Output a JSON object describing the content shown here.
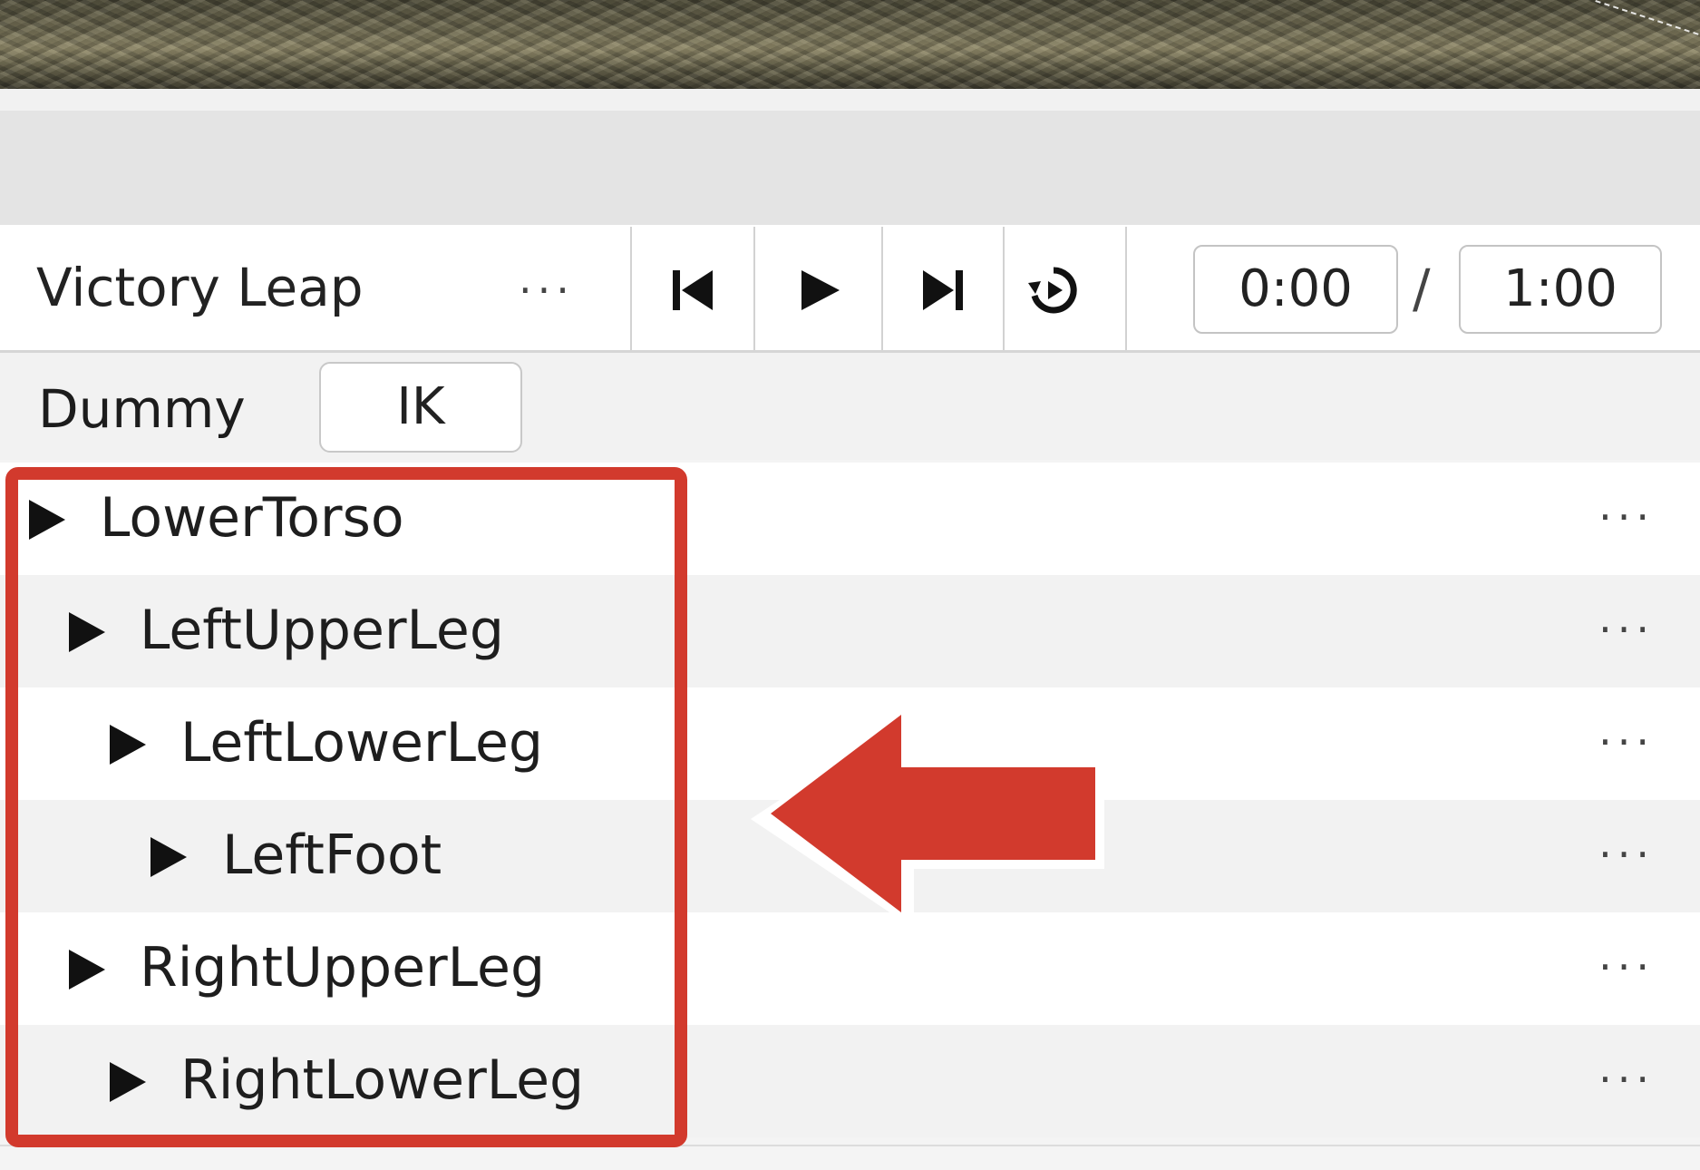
{
  "animation": {
    "title": "Victory Leap",
    "menu": "···",
    "current_time": "0:00",
    "separator": "/",
    "duration": "1:00"
  },
  "transport": {
    "icons": [
      "skip-to-start-icon",
      "play-icon",
      "skip-to-end-icon",
      "loop-icon"
    ]
  },
  "rig": {
    "name": "Dummy",
    "ik_label": "IK"
  },
  "tree": {
    "menu": "···",
    "items": [
      {
        "label": "LowerTorso",
        "depth": 0
      },
      {
        "label": "LeftUpperLeg",
        "depth": 1
      },
      {
        "label": "LeftLowerLeg",
        "depth": 2
      },
      {
        "label": "LeftFoot",
        "depth": 3
      },
      {
        "label": "RightUpperLeg",
        "depth": 1
      },
      {
        "label": "RightLowerLeg",
        "depth": 2
      }
    ]
  },
  "annotation": {
    "color": "#d23a2d"
  }
}
